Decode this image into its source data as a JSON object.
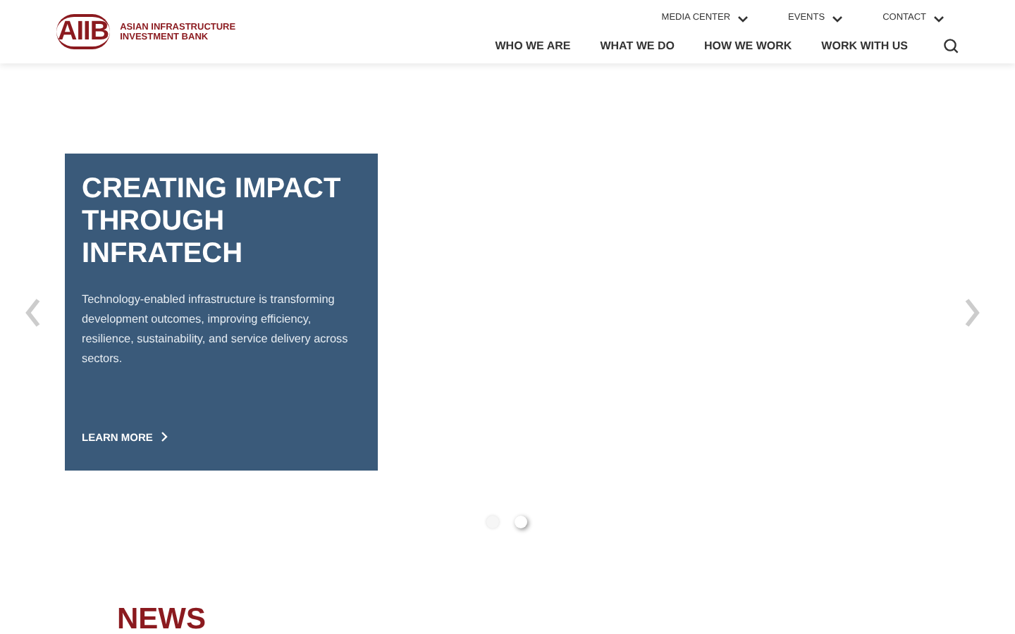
{
  "header": {
    "logo": {
      "mark": "AIIB",
      "name_line_1": "ASIAN INFRASTRUCTURE",
      "name_line_2": "INVESTMENT BANK"
    },
    "utility_nav": [
      {
        "label": "MEDIA CENTER"
      },
      {
        "label": "EVENTS"
      },
      {
        "label": "CONTACT"
      }
    ],
    "main_nav": [
      {
        "label": "WHO WE ARE"
      },
      {
        "label": "WHAT WE DO"
      },
      {
        "label": "HOW WE WORK"
      },
      {
        "label": "WORK WITH US"
      }
    ]
  },
  "hero": {
    "title": "CREATING IMPACT THROUGH INFRATECH",
    "body": "Technology-enabled infrastructure is transforming development outcomes, improving efficiency, resilience, sustainability, and service delivery across sectors.",
    "link": "LEARN MORE",
    "dots": [
      {
        "selected": false
      },
      {
        "selected": true
      }
    ]
  },
  "news": {
    "heading": "NEWS"
  }
}
